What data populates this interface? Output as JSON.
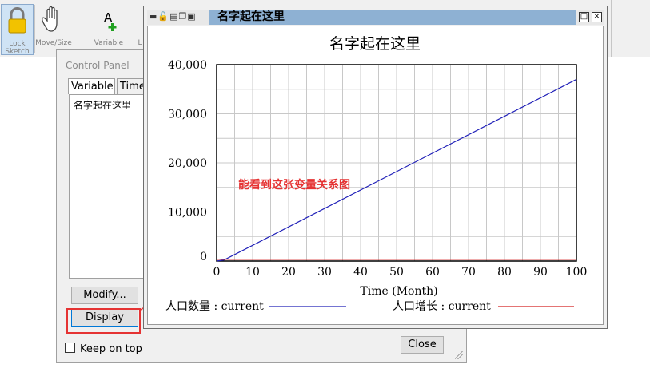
{
  "toolbar": {
    "tools": [
      {
        "label_line1": "Lock",
        "label_line2": "Sketch"
      },
      {
        "label": "Move/Size"
      },
      {
        "label": "Variable",
        "glyph": "A"
      },
      {
        "label": "L"
      }
    ]
  },
  "control_panel": {
    "title": "Control Panel",
    "tabs": [
      "Variable",
      "Time"
    ],
    "list_items": [
      "名字起在这里"
    ],
    "modify_label": "Modify...",
    "display_label": "Display",
    "keep_on_top_label": "Keep on top",
    "close_label": "Close"
  },
  "graph_window": {
    "title": "名字起在这里",
    "toolbar_icons": [
      "minimize-icon",
      "lock-icon",
      "print-icon",
      "copy-icon",
      "save-icon"
    ]
  },
  "chart_data": {
    "type": "line",
    "title": "名字起在这里",
    "xlabel": "Time (Month)",
    "ylabel": "",
    "xlim": [
      0,
      100
    ],
    "ylim": [
      0,
      40000
    ],
    "x_ticks": [
      0,
      10,
      20,
      30,
      40,
      50,
      60,
      70,
      80,
      90,
      100
    ],
    "y_ticks": [
      0,
      10000,
      20000,
      30000,
      40000
    ],
    "y_tick_labels": [
      "0",
      "10,000",
      "20,000",
      "30,000",
      "40,000"
    ],
    "grid": true,
    "annotation": "能看到这张变量关系图",
    "series": [
      {
        "name": "人口数量 : current",
        "color": "#2020b8",
        "x": [
          0,
          2,
          100
        ],
        "y": [
          0,
          200,
          37000
        ]
      },
      {
        "name": "人口增长 : current",
        "color": "#d42020",
        "x": [
          0,
          100
        ],
        "y": [
          370,
          370
        ]
      }
    ]
  },
  "colors": {
    "highlight": "#e53333",
    "title_bar": "#8eb1d3",
    "annotation": "#e53333"
  }
}
